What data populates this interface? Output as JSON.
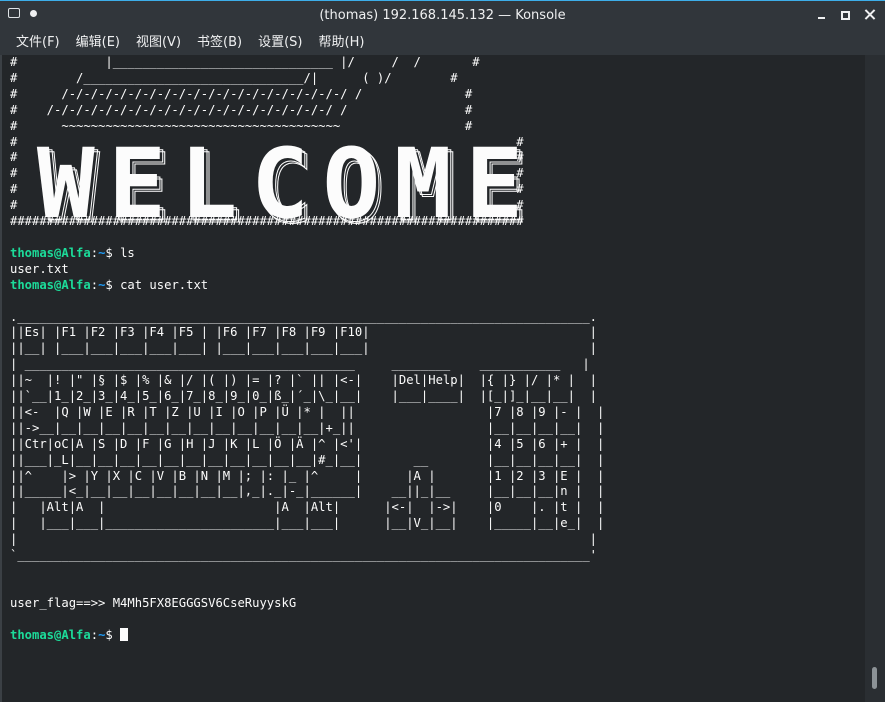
{
  "window": {
    "title": "(thomas) 192.168.145.132 — Konsole"
  },
  "menu": {
    "items": [
      "文件(F)",
      "编辑(E)",
      "视图(V)",
      "书签(B)",
      "设置(S)",
      "帮助(H)"
    ]
  },
  "terminal": {
    "art_top": [
      "#            |______________________________ |/     /  /       #",
      "#        /______________________________/|      ( )/        #",
      "#      /-/-/-/-/-/-/-/-/-/-/-/-/-/-/-/-/-/-/-/ /              #",
      "#    /-/-/-/-/-/-/-/-/-/-/-/-/-/-/-/-/-/-/-/ /                #",
      "#      ~~~~~~~~~~~~~~~~~~~~~~~~~~~~~~~~~~~~~~                 #"
    ],
    "hash_rows": 5,
    "banner_word": "WELCOME",
    "separator": "######################################################################",
    "prompt": {
      "user": "thomas@Alfa",
      "path": "~",
      "symbol": "$"
    },
    "history": [
      {
        "type": "cmd",
        "text": " ls"
      },
      {
        "type": "out",
        "text": "user.txt"
      },
      {
        "type": "cmd",
        "text": " cat user.txt"
      }
    ],
    "keyboard_art": [
      "",
      ".______________________________________________________________________________.",
      "||Es| |F1 |F2 |F3 |F4 |F5 | |F6 |F7 |F8 |F9 |F10|                              |",
      "||__| |___|___|___|___|___| |___|___|___|___|___|                              |",
      "| _____________________________________________     ________    ___________   |",
      "||~  |! |\" |§ |$ |% |& |/ |( |) |= |? |` || |<-|    |Del|Help|  |{ |} |/ |* |  |",
      "||`__|1_|2_|3_|4_|5_|6_|7_|8_|9_|0_|ß_|´_|\\_|__|    |___|____|  |[_|]_|__|__|  |",
      "||<-  |Q |W |E |R |T |Z |U |I |O |P |Ü |* |  ||                  |7 |8 |9 |- |  |",
      "||->__|__|__|__|__|__|__|__|__|__|__|__|__|+_||                  |__|__|__|__|  |",
      "||Ctr|oC|A |S |D |F |G |H |J |K |L |Ö |Ä |^ |<'|                 |4 |5 |6 |+ |  |",
      "||___|_L|__|__|__|__|__|__|__|__|__|__|__|#_|__|       __        |__|__|__|__|  |",
      "||^    |> |Y |X |C |V |B |N |M |; |: |_ |^     |      |A |       |1 |2 |3 |E |  |",
      "||_____|<_|__|__|__|__|__|__|__|,_|._|-_|______|    __||_|__     |__|__|__|n |  |",
      "|   |Alt|A  |                       |A  |Alt|      |<-|  |->|    |0    |. |t |  |",
      "|   |___|___|_______________________|___|___|      |__|V_|__|    |_____|__|e_|  |",
      "|                                                                              |",
      "`______________________________________________________________________________'"
    ],
    "flag_line": "user_flag==>> M4Mh5FX8EGGGSV6CseRuyyskG"
  }
}
